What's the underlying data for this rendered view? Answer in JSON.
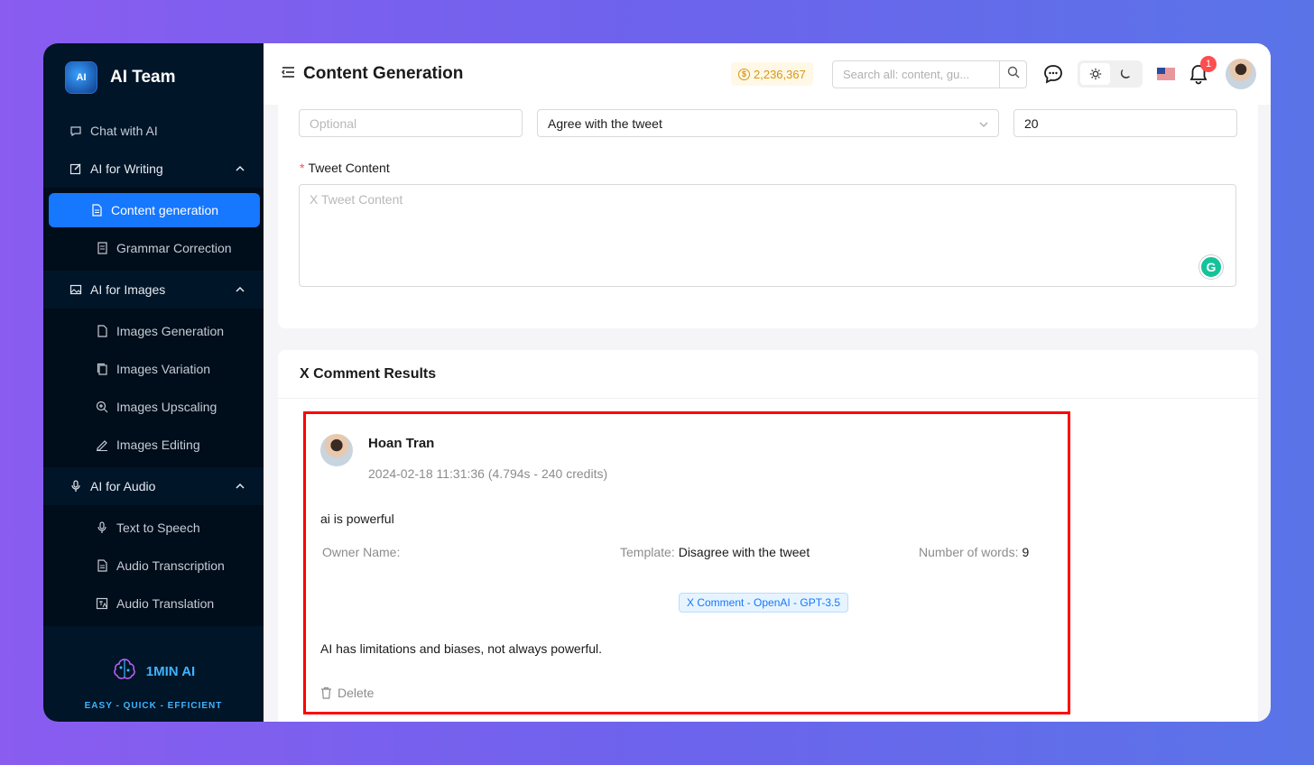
{
  "sidebar": {
    "brand": "AI Team",
    "brand_logo_text": "AI",
    "items": [
      {
        "label": "Chat with AI",
        "icon": "chat-icon"
      },
      {
        "label": "AI for Writing",
        "icon": "edit-icon",
        "expanded": true,
        "children": [
          {
            "label": "Content generation",
            "icon": "file-icon",
            "active": true
          },
          {
            "label": "Grammar Correction",
            "icon": "checklist-icon"
          }
        ]
      },
      {
        "label": "AI for Images",
        "icon": "image-icon",
        "expanded": true,
        "children": [
          {
            "label": "Images Generation",
            "icon": "file-icon"
          },
          {
            "label": "Images Variation",
            "icon": "copy-icon"
          },
          {
            "label": "Images Upscaling",
            "icon": "zoom-in-icon"
          },
          {
            "label": "Images Editing",
            "icon": "pen-icon"
          }
        ]
      },
      {
        "label": "AI for Audio",
        "icon": "microphone-icon",
        "expanded": true,
        "children": [
          {
            "label": "Text to Speech",
            "icon": "microphone-icon"
          },
          {
            "label": "Audio Transcription",
            "icon": "file-icon"
          },
          {
            "label": "Audio Translation",
            "icon": "translate-icon"
          }
        ]
      }
    ],
    "footer": {
      "name": "1MIN AI",
      "tagline": "EASY - QUICK - EFFICIENT"
    }
  },
  "header": {
    "title": "Content Generation",
    "credits": "2,236,367",
    "search_placeholder": "Search all: content, gu...",
    "notification_count": "1"
  },
  "form": {
    "optional_placeholder": "Optional",
    "template_value": "Agree with the tweet",
    "words_value": "20",
    "tweet_label": "Tweet Content",
    "tweet_placeholder": "X Tweet Content"
  },
  "results": {
    "title": "X Comment Results",
    "item": {
      "user": "Hoan Tran",
      "meta": "2024-02-18 11:31:36 (4.794s - 240 credits)",
      "prompt": "ai is powerful",
      "owner_label": "Owner Name",
      "owner_value": "",
      "template_label": "Template",
      "template_value": "Disagree with the tweet",
      "words_label": "Number of words",
      "words_value": "9",
      "tag": "X Comment - OpenAI - GPT-3.5",
      "answer": "AI has limitations and biases, not always powerful.",
      "delete_label": "Delete"
    }
  },
  "colors": {
    "accent": "#1677ff",
    "sidebar_bg": "#011528",
    "highlight_border": "#ff0000"
  }
}
